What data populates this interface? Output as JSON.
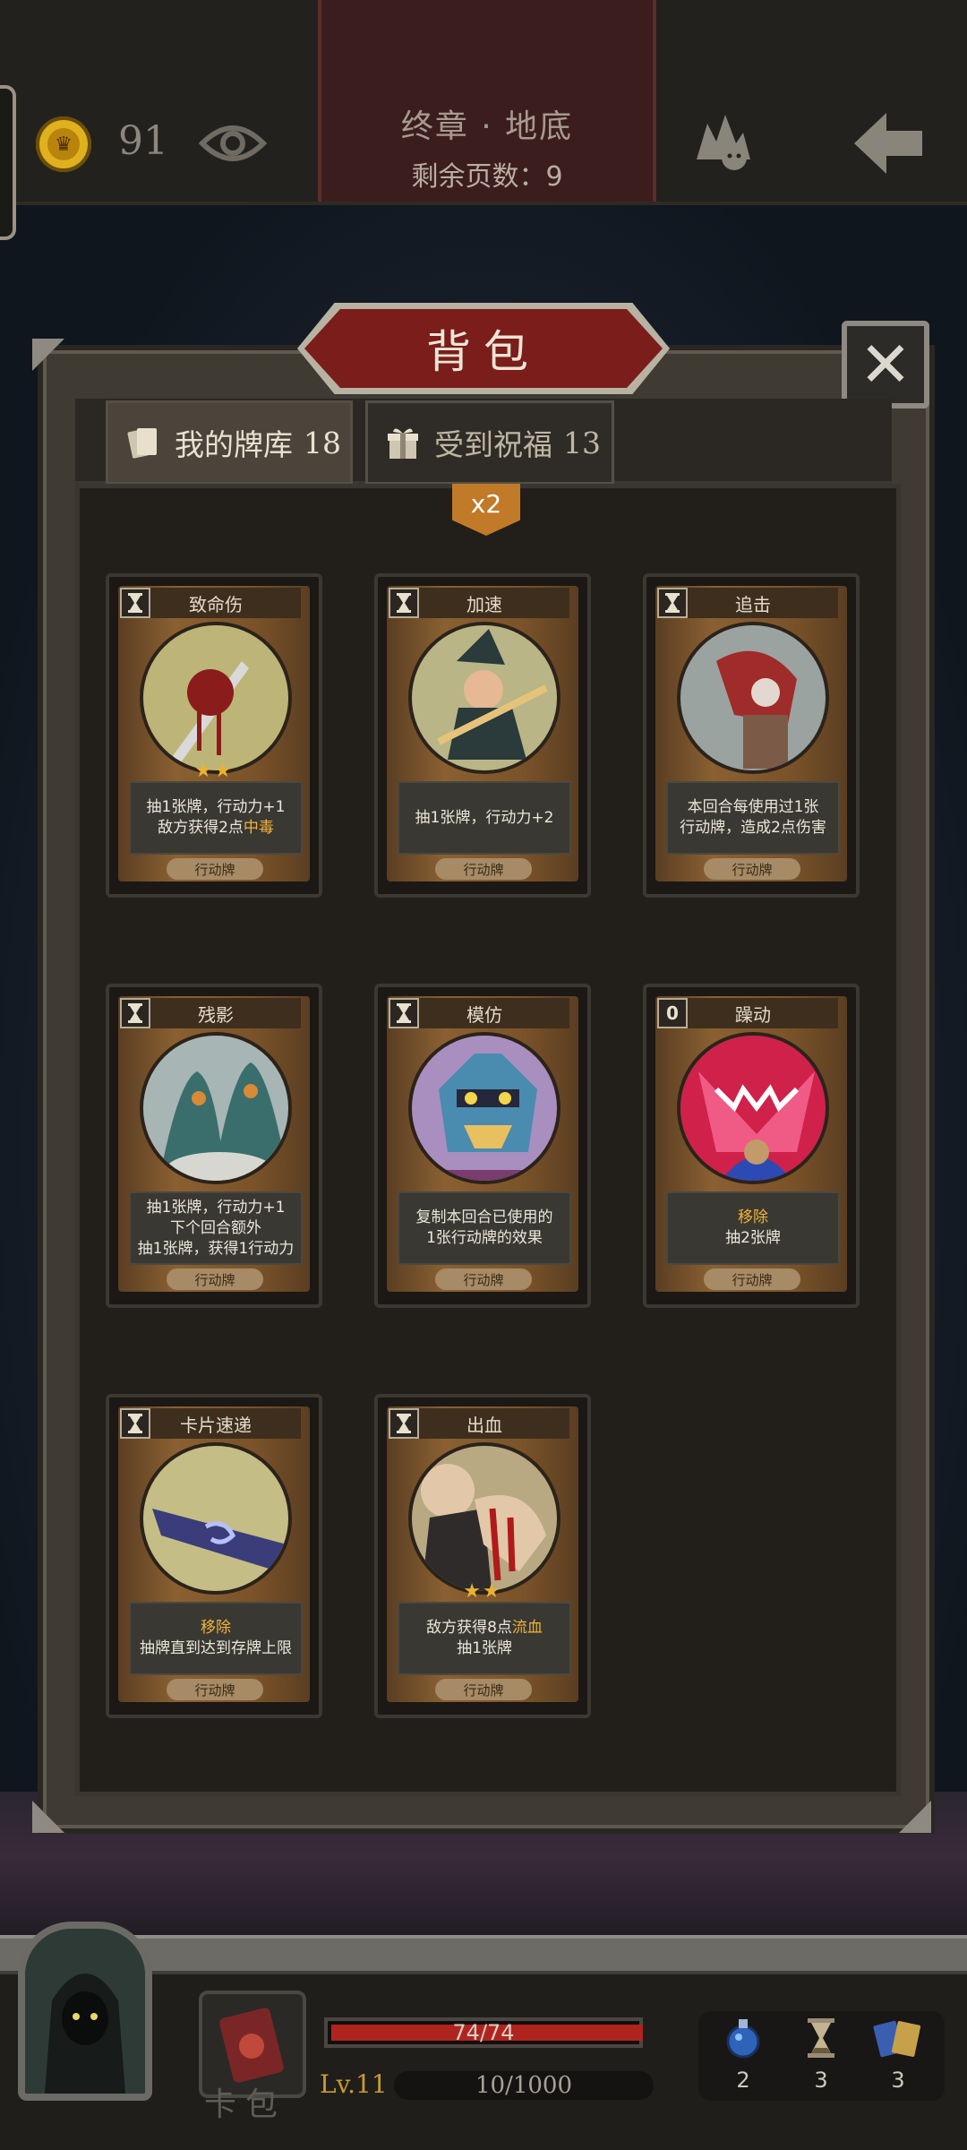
{
  "topbar": {
    "coins": "91",
    "chapter_title": "终章 · 地底",
    "pages_left": "剩余页数：9"
  },
  "panel": {
    "title": "背包",
    "close_label": "✕",
    "tabs": [
      {
        "label": "我的牌库",
        "count": "18"
      },
      {
        "label": "受到祝福",
        "count": "13"
      }
    ],
    "multiplier": "x2"
  },
  "cards": [
    {
      "cost": "",
      "name": "致命伤",
      "stars": "★★",
      "desc_lines": [
        "抽1张牌，行动力+1",
        "敌方获得2点"
      ],
      "desc_kw": "中毒",
      "type": "行动牌"
    },
    {
      "cost": "",
      "name": "加速",
      "stars": "",
      "desc_lines": [
        "抽1张牌，行动力+2"
      ],
      "desc_kw": "",
      "type": "行动牌"
    },
    {
      "cost": "",
      "name": "追击",
      "stars": "",
      "desc_lines": [
        "本回合每使用过1张",
        "行动牌，造成2点伤害"
      ],
      "desc_kw": "",
      "type": "行动牌"
    },
    {
      "cost": "",
      "name": "残影",
      "stars": "",
      "desc_lines": [
        "抽1张牌，行动力+1",
        "下个回合额外",
        "抽1张牌，获得1行动力"
      ],
      "desc_kw": "",
      "type": "行动牌"
    },
    {
      "cost": "",
      "name": "模仿",
      "stars": "",
      "desc_lines": [
        "复制本回合已使用的",
        "1张行动牌的效果"
      ],
      "desc_kw": "",
      "type": "行动牌"
    },
    {
      "cost": "0",
      "name": "躁动",
      "stars": "",
      "desc_kw_top": "移除",
      "desc_lines": [
        "抽2张牌"
      ],
      "desc_kw": "",
      "type": "行动牌"
    },
    {
      "cost": "",
      "name": "卡片速递",
      "stars": "",
      "desc_kw_top": "移除",
      "desc_lines": [
        "抽牌直到达到存牌上限"
      ],
      "desc_kw": "",
      "type": "行动牌"
    },
    {
      "cost": "",
      "name": "出血",
      "stars": "★★",
      "desc_lines": [
        "敌方获得8点",
        "抽1张牌"
      ],
      "desc_kw": "流血",
      "type": "行动牌"
    }
  ],
  "hud": {
    "card_bag_label": "卡包",
    "hp_text": "74/74",
    "hp_fraction": 1.0,
    "level": "Lv.11",
    "xp_text": "10/1000",
    "resources": [
      {
        "icon": "potion-icon",
        "count": "2"
      },
      {
        "icon": "hourglass-icon",
        "count": "3"
      },
      {
        "icon": "cards-icon",
        "count": "3"
      }
    ]
  }
}
